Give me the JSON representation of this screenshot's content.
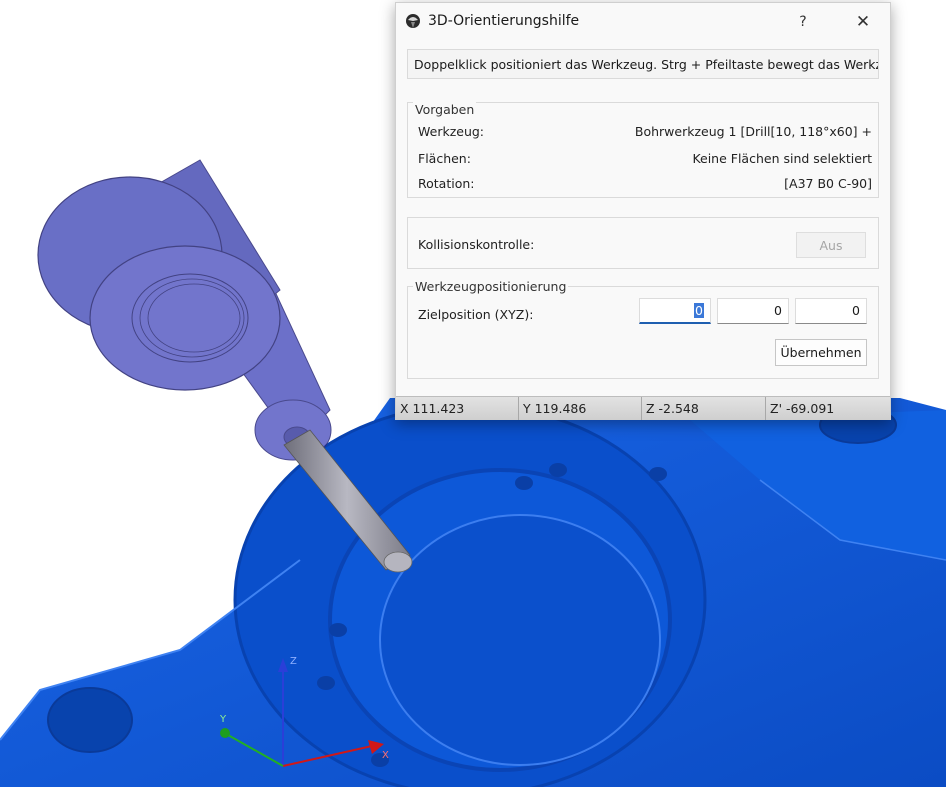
{
  "dialog": {
    "title": "3D-Orientierungshilfe",
    "help_label": "?",
    "close_label": "✕",
    "hint": "Doppelklick positioniert das Werkzeug. Strg + Pfeiltaste bewegt das Werkzeug",
    "vorgaben": {
      "title": "Vorgaben",
      "rows": [
        {
          "label": "Werkzeug:",
          "value": "Bohrwerkzeug 1 [Drill[10, 118°x60] +"
        },
        {
          "label": "Flächen:",
          "value": "Keine Flächen sind selektiert"
        },
        {
          "label": "Rotation:",
          "value": "[A37 B0 C-90]"
        }
      ]
    },
    "collision": {
      "label": "Kollisionskontrolle:",
      "button": "Aus"
    },
    "positioning": {
      "title": "Werkzeugpositionierung",
      "label": "Zielposition (XYZ):",
      "x": "0",
      "y": "0",
      "z": "0",
      "apply": "Übernehmen"
    },
    "status": {
      "x": "X  111.423",
      "y": "Y  119.486",
      "z": "Z  -2.548",
      "zp": "Z'  -69.091"
    }
  },
  "axes": {
    "x": "X",
    "y": "Y",
    "z": "Z"
  },
  "colors": {
    "workpiece": "#0d57d6",
    "tool_holder": "#5a5ec4",
    "drill": "#9c9ca8",
    "accent": "#1f5fb0"
  },
  "icons": {
    "title": "app-icon"
  }
}
